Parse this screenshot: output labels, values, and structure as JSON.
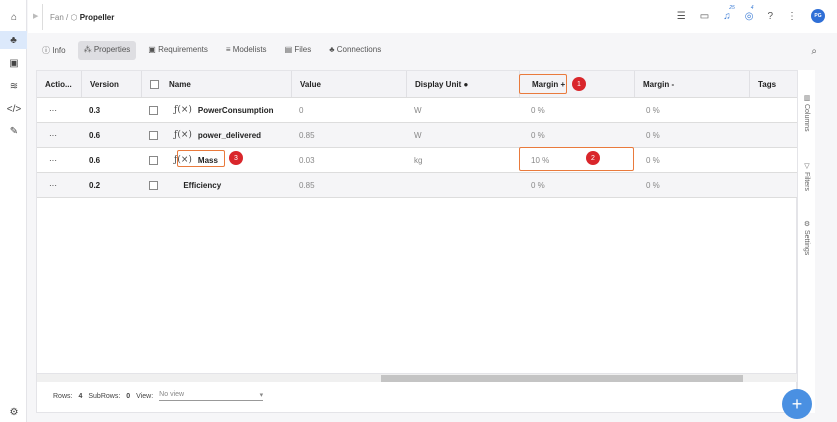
{
  "breadcrumb": {
    "parent": "Fan",
    "current": "Propeller"
  },
  "header": {
    "notifications_count": "25",
    "tasks_count": "4",
    "avatar_initials": "PG"
  },
  "tabs": [
    {
      "label": "Info"
    },
    {
      "label": "Properties"
    },
    {
      "label": "Requirements"
    },
    {
      "label": "Modelists"
    },
    {
      "label": "Files"
    },
    {
      "label": "Connections"
    }
  ],
  "table": {
    "columns": [
      "Actio...",
      "Version",
      "Name",
      "Value",
      "Display Unit",
      "Margin +",
      "Margin -",
      "Tags"
    ],
    "rows": [
      {
        "actions": "···",
        "version": "0.3",
        "name": "PowerConsumption",
        "value": "0",
        "unit": "W",
        "margin_plus": "0 %",
        "margin_minus": "0 %"
      },
      {
        "actions": "···",
        "version": "0.6",
        "name": "power_delivered",
        "value": "0.85",
        "unit": "W",
        "margin_plus": "0 %",
        "margin_minus": "0 %"
      },
      {
        "actions": "···",
        "version": "0.6",
        "name": "Mass",
        "value": "0.03",
        "unit": "kg",
        "margin_plus": "10 %",
        "margin_minus": "0 %"
      },
      {
        "actions": "···",
        "version": "0.2",
        "name": "Efficiency",
        "value": "0.85",
        "unit": "",
        "margin_plus": "0 %",
        "margin_minus": "0 %"
      }
    ]
  },
  "side_panel": {
    "columns": "Columns",
    "filters": "Filters",
    "settings": "Settings"
  },
  "footer": {
    "rows_label": "Rows:",
    "rows": "4",
    "subrows_label": "SubRows:",
    "subrows": "0",
    "view_label": "View:",
    "view_value": "No view"
  },
  "annotations": [
    "1",
    "2",
    "3"
  ]
}
